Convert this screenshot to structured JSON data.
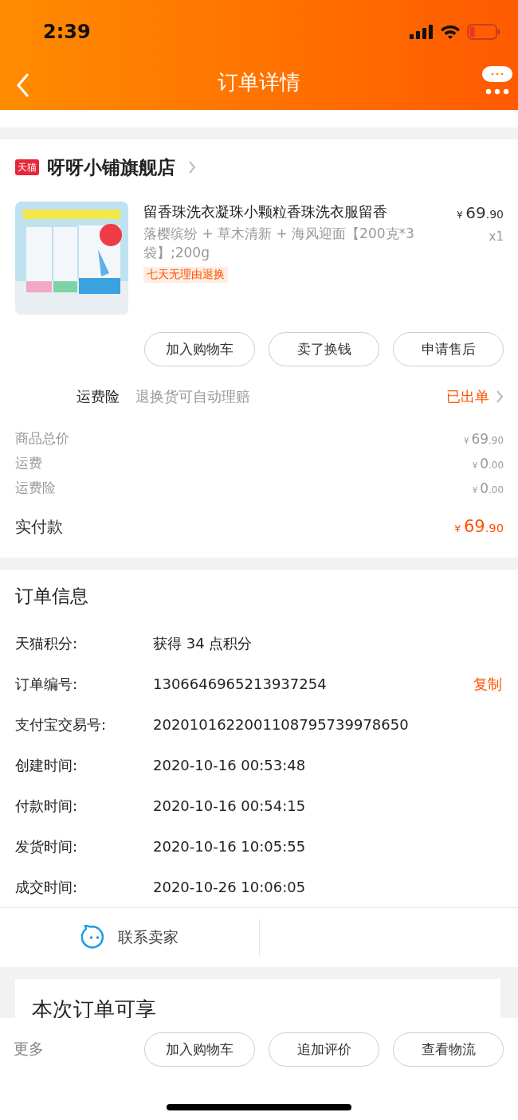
{
  "status_bar": {
    "time": "2:39"
  },
  "nav": {
    "title": "订单详情"
  },
  "store": {
    "badge": "天猫",
    "name": "呀呀小铺旗舰店"
  },
  "product": {
    "title": "留香珠洗衣凝珠小颗粒香珠洗衣服留香",
    "sku": "落樱缤纷 + 草木清新 + 海风迎面【200克*3袋】;200g",
    "price": {
      "currency": "¥",
      "integer": "69",
      "decimal": ".90"
    },
    "quantity": "x1",
    "tag": "七天无理由退换"
  },
  "product_actions": [
    "加入购物车",
    "卖了换钱",
    "申请售后"
  ],
  "insurance": {
    "label": "运费险",
    "description": "退换货可自动理赔",
    "status": "已出单"
  },
  "summary": [
    {
      "label": "商品总价",
      "price": {
        "currency": "¥",
        "integer": "69",
        "decimal": ".90"
      }
    },
    {
      "label": "运费",
      "price": {
        "currency": "¥",
        "integer": "0",
        "decimal": ".00"
      }
    },
    {
      "label": "运费险",
      "price": {
        "currency": "¥",
        "integer": "0",
        "decimal": ".00"
      }
    }
  ],
  "total": {
    "label": "实付款",
    "price": {
      "currency": "¥",
      "integer": "69",
      "decimal": ".90"
    }
  },
  "order_info": {
    "title": "订单信息",
    "rows": [
      {
        "label": "天猫积分:",
        "value": "获得 34 点积分"
      },
      {
        "label": "订单编号:",
        "value": "1306646965213937254",
        "action": "复制"
      },
      {
        "label": "支付宝交易号:",
        "value": "2020101622001108795739978650"
      },
      {
        "label": "创建时间:",
        "value": "2020-10-16 00:53:48"
      },
      {
        "label": "付款时间:",
        "value": "2020-10-16 00:54:15"
      },
      {
        "label": "发货时间:",
        "value": "2020-10-16 10:05:55"
      },
      {
        "label": "成交时间:",
        "value": "2020-10-26 10:06:05"
      }
    ]
  },
  "contact": {
    "label": "联系卖家"
  },
  "benefits": {
    "title": "本次订单可享"
  },
  "bottom_bar": {
    "more": "更多",
    "buttons": [
      "加入购物车",
      "追加评价",
      "查看物流"
    ]
  }
}
